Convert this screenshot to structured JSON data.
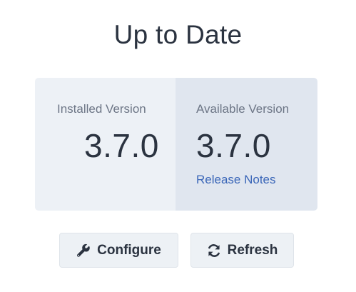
{
  "page": {
    "title": "Up to Date"
  },
  "installed": {
    "label": "Installed Version",
    "version": "3.7.0"
  },
  "available": {
    "label": "Available Version",
    "version": "3.7.0",
    "release_notes_label": "Release Notes"
  },
  "actions": {
    "configure_label": "Configure",
    "configure_icon": "wrench-icon",
    "refresh_label": "Refresh",
    "refresh_icon": "refresh-icon"
  },
  "colors": {
    "installed_panel_bg": "#edf1f6",
    "available_panel_bg": "#e0e6ef",
    "link": "#3a66b8",
    "text": "#2b3340",
    "muted_text": "#6d7686"
  }
}
